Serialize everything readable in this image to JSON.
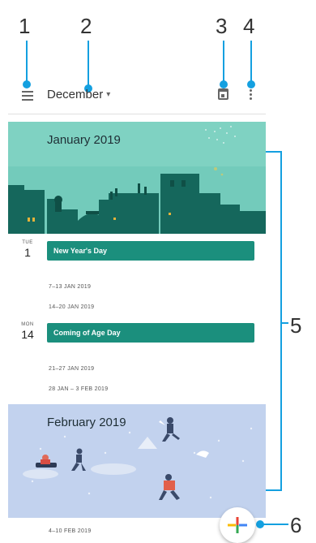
{
  "callouts": [
    "1",
    "2",
    "3",
    "4",
    "5",
    "6"
  ],
  "header": {
    "menu_icon": "menu-icon",
    "month_label": "December",
    "caret_icon": "dropdown-caret-icon",
    "today_icon": "calendar-today-icon",
    "more_icon": "more-vertical-icon"
  },
  "banners": {
    "january": "January 2019",
    "february": "February 2019"
  },
  "days": [
    {
      "dow": "TUE",
      "day": "1",
      "event": "New Year's Day"
    },
    {
      "dow": "MON",
      "day": "14",
      "event": "Coming of Age Day"
    }
  ],
  "weeks": [
    "7–13 JAN 2019",
    "14–20 JAN 2019",
    "21–27 JAN 2019",
    "28 JAN – 3 FEB 2019",
    "4–10 FEB 2019"
  ],
  "fab": {
    "icon": "add-plus-icon"
  },
  "colors": {
    "callout_line": "#14a0e0",
    "event_fill": "#1b8f7d",
    "jan_banner": "#7fd2c2",
    "feb_banner": "#c2d2ee"
  }
}
